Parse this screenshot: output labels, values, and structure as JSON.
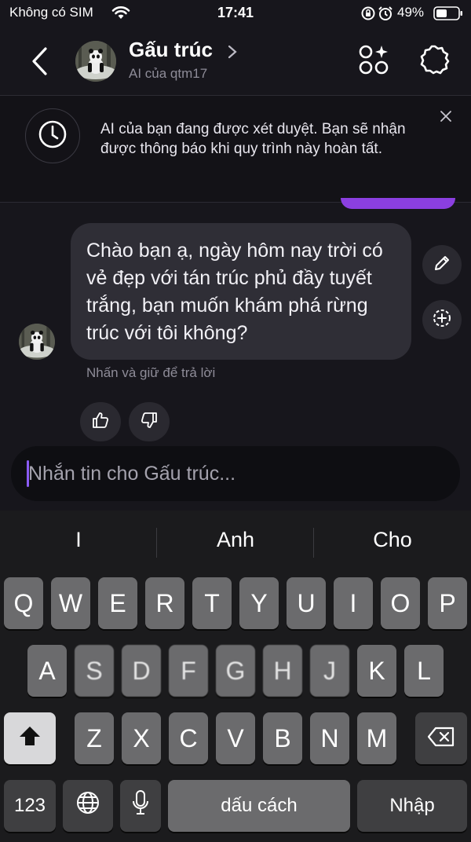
{
  "status_bar": {
    "carrier": "Không có SIM",
    "time": "17:41",
    "battery": "49%"
  },
  "header": {
    "name": "Gấu trúc",
    "subtitle": "AI của qtm17",
    "icons": [
      "back-icon",
      "chevron-right-icon",
      "apps-sparkle-icon",
      "settings-icon"
    ]
  },
  "banner": {
    "text": "AI của bạn đang được xét duyệt. Bạn sẽ nhận được thông báo khi quy trình này hoàn tất.",
    "icons": [
      "clock-icon",
      "close-icon"
    ]
  },
  "message": {
    "text": "Chào bạn ạ, ngày hôm nay trời có vẻ đẹp với tán trúc phủ đầy tuyết trắng, bạn muốn khám phá rừng trúc với tôi không?",
    "hint": "Nhấn và giữ để trả lời",
    "icons": [
      "pencil-icon",
      "regenerate-icon",
      "thumbs-up-icon",
      "thumbs-down-icon"
    ]
  },
  "composer": {
    "placeholder": "Nhắn tin cho Gấu trúc..."
  },
  "keyboard": {
    "suggestions": [
      "I",
      "Anh",
      "Cho"
    ],
    "row1": [
      "Q",
      "W",
      "E",
      "R",
      "T",
      "Y",
      "U",
      "I",
      "O",
      "P"
    ],
    "row2": [
      "A",
      "S",
      "D",
      "F",
      "G",
      "H",
      "J",
      "K",
      "L"
    ],
    "row3": [
      "Z",
      "X",
      "C",
      "V",
      "B",
      "N",
      "M"
    ],
    "numbers_label": "123",
    "space_label": "dấu cách",
    "return_label": "Nhập"
  },
  "colors": {
    "background": "#17161c",
    "bubble": "#2f2e36",
    "accent": "#8b3fe0"
  }
}
